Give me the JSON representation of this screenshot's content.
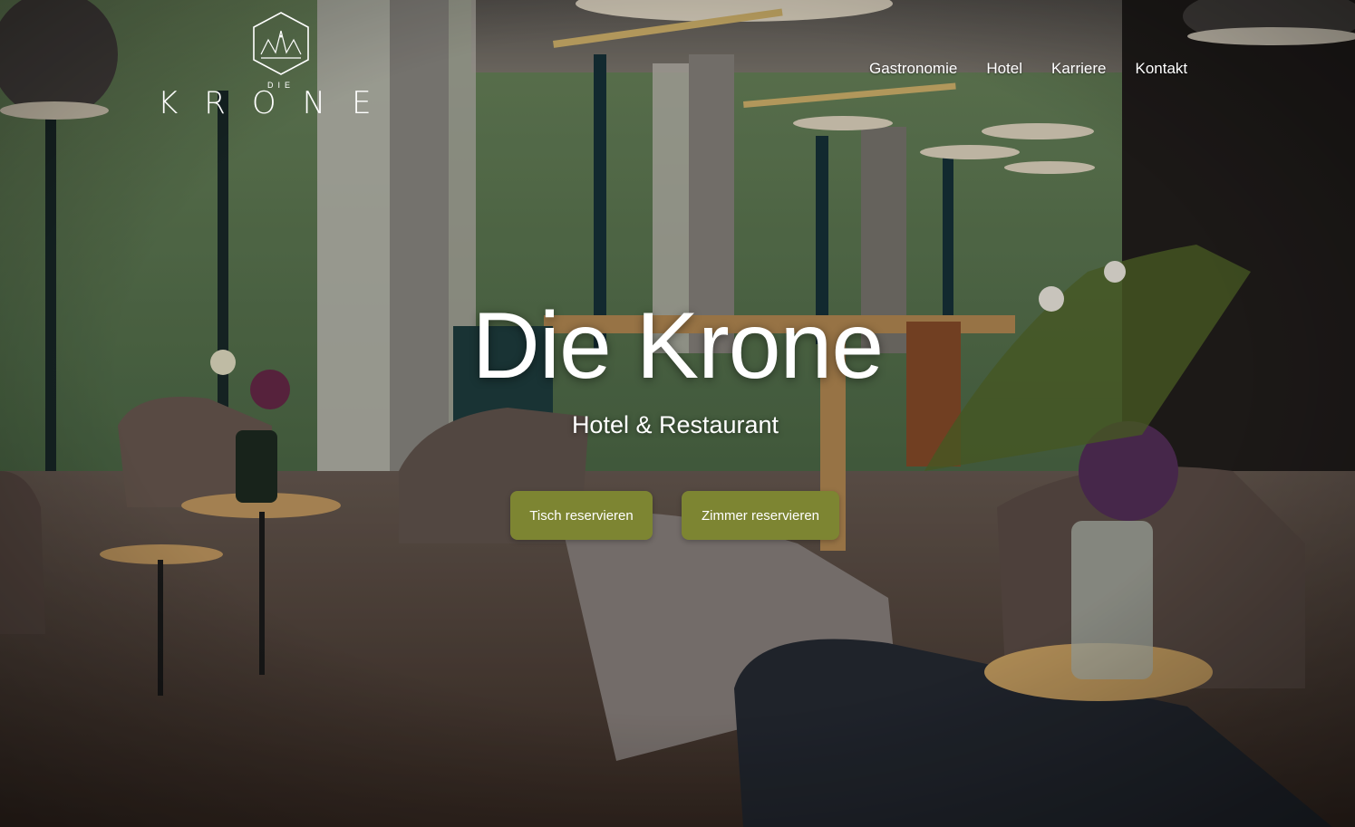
{
  "brand": {
    "logo_top": "DIE",
    "logo_word": "KRONE"
  },
  "nav": {
    "items": [
      "Gastronomie",
      "Hotel",
      "Karriere",
      "Kontakt"
    ]
  },
  "hero": {
    "title": "Die Krone",
    "subtitle": "Hotel & Restaurant",
    "buttons": {
      "table": "Tisch reservieren",
      "room": "Zimmer reservieren"
    }
  },
  "colors": {
    "accent": "#7d8532",
    "text": "#ffffff"
  }
}
